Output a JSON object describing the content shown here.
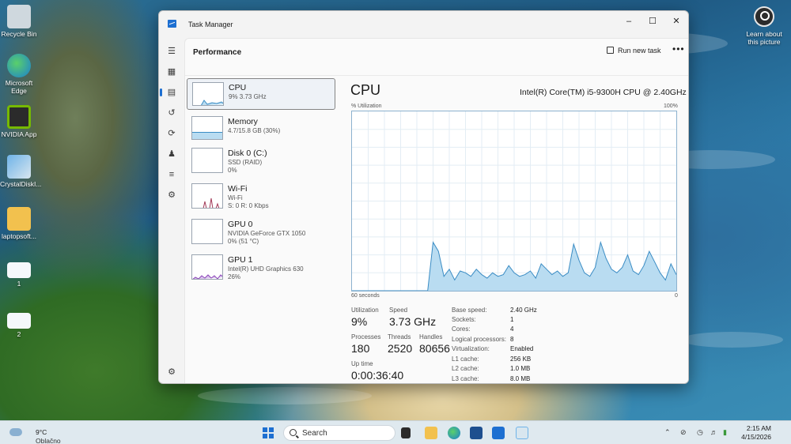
{
  "desktop": {
    "icons": [
      {
        "label": "Recycle Bin"
      },
      {
        "label": "Microsoft Edge"
      },
      {
        "label": "NVIDIA App"
      },
      {
        "label": "CrystalDiskI..."
      },
      {
        "label": "laptopsoft..."
      },
      {
        "label": "1"
      },
      {
        "label": "2"
      }
    ],
    "learn_label": "Learn about this picture"
  },
  "window": {
    "title": "Task Manager",
    "page_title": "Performance",
    "run_new_task": "Run new task",
    "more_label": "•••"
  },
  "devices": [
    {
      "name": "CPU",
      "line1": "9%  3.73 GHz",
      "line2": ""
    },
    {
      "name": "Memory",
      "line1": "4.7/15.8 GB (30%)",
      "line2": ""
    },
    {
      "name": "Disk 0 (C:)",
      "line1": "SSD (RAID)",
      "line2": "0%"
    },
    {
      "name": "Wi-Fi",
      "line1": "Wi-Fi",
      "line2": "S: 0  R: 0 Kbps"
    },
    {
      "name": "GPU 0",
      "line1": "NVIDIA GeForce GTX 1050",
      "line2": "0%  (51 °C)"
    },
    {
      "name": "GPU 1",
      "line1": "Intel(R) UHD Graphics 630",
      "line2": "26%"
    }
  ],
  "detail": {
    "title": "CPU",
    "model": "Intel(R) Core(TM) i5-9300H CPU @ 2.40GHz",
    "util_label": "% Utilization",
    "max_label": "100%",
    "time_label": "60 seconds",
    "zero_label": "0",
    "stats": {
      "utilization_label": "Utilization",
      "utilization": "9%",
      "speed_label": "Speed",
      "speed": "3.73 GHz",
      "processes_label": "Processes",
      "processes": "180",
      "threads_label": "Threads",
      "threads": "2520",
      "handles_label": "Handles",
      "handles": "80656",
      "uptime_label": "Up time",
      "uptime": "0:00:36:40"
    },
    "props": [
      {
        "label": "Base speed:",
        "value": "2.40 GHz"
      },
      {
        "label": "Sockets:",
        "value": "1"
      },
      {
        "label": "Cores:",
        "value": "4"
      },
      {
        "label": "Logical processors:",
        "value": "8"
      },
      {
        "label": "Virtualization:",
        "value": "Enabled"
      },
      {
        "label": "L1 cache:",
        "value": "256 KB"
      },
      {
        "label": "L2 cache:",
        "value": "1.0 MB"
      },
      {
        "label": "L3 cache:",
        "value": "8.0 MB"
      }
    ]
  },
  "chart_data": {
    "type": "area",
    "title": "CPU",
    "ylabel": "% Utilization",
    "ylim": [
      0,
      100
    ],
    "x_range": "60 seconds",
    "values": [
      0,
      0,
      0,
      0,
      0,
      0,
      0,
      0,
      0,
      0,
      0,
      0,
      0,
      0,
      0,
      27,
      22,
      8,
      12,
      6,
      11,
      10,
      8,
      12,
      9,
      7,
      10,
      8,
      9,
      14,
      10,
      8,
      9,
      11,
      7,
      15,
      12,
      9,
      11,
      8,
      10,
      26,
      17,
      10,
      8,
      13,
      27,
      18,
      12,
      10,
      13,
      20,
      11,
      9,
      14,
      22,
      16,
      10,
      6,
      15,
      9
    ]
  },
  "colors": {
    "accent": "#1d6fd1",
    "graph_fill": "#b9dcf1",
    "graph_line": "#3a8cc4",
    "graph_grid": "#e3edf4"
  },
  "taskbar": {
    "temp": "9°C",
    "condition": "Oblačno",
    "search_placeholder": "Search",
    "time": "2:15 AM",
    "date": "4/15/2026"
  }
}
